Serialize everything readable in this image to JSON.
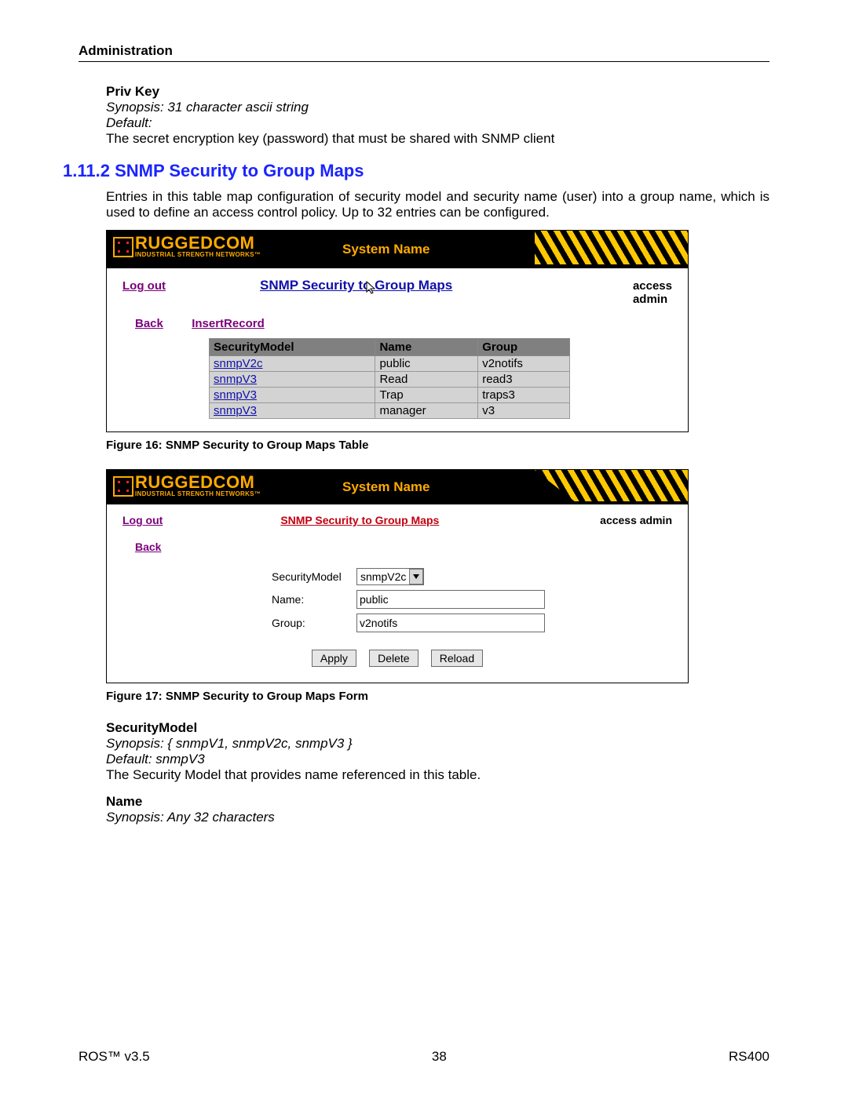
{
  "chapter": "Administration",
  "priv_key": {
    "heading": "Priv Key",
    "synopsis": "Synopsis: 31 character ascii string",
    "default": "Default:",
    "desc": "The secret encryption key (password) that must be shared with SNMP client"
  },
  "section": {
    "number_title": "1.11.2  SNMP Security to Group Maps",
    "para": "Entries in this table map configuration of security model and security name (user) into a group name, which is used to define an access control policy. Up to 32 entries can be configured."
  },
  "brand": {
    "name": "RUGGEDCOM",
    "tagline": "INDUSTRIAL STRENGTH NETWORKS™"
  },
  "screenshot1": {
    "system_name": "System Name",
    "logout": "Log out",
    "page_title": "SNMP Security to Group Maps",
    "access_line1": "access",
    "access_line2": "admin",
    "back": "Back",
    "insert_record": "InsertRecord",
    "columns": {
      "c1": "SecurityModel",
      "c2": "Name",
      "c3": "Group"
    },
    "rows": [
      {
        "model": "snmpV2c",
        "name": "public",
        "group": "v2notifs"
      },
      {
        "model": "snmpV3",
        "name": "Read",
        "group": "read3"
      },
      {
        "model": "snmpV3",
        "name": "Trap",
        "group": "traps3"
      },
      {
        "model": "snmpV3",
        "name": "manager",
        "group": "v3"
      }
    ],
    "caption": "Figure 16: SNMP Security to Group Maps Table"
  },
  "screenshot2": {
    "system_name": "System Name",
    "logout": "Log out",
    "page_title": "SNMP Security to Group Maps",
    "access": "access admin",
    "back": "Back",
    "labels": {
      "sec_model": "SecurityModel",
      "name": "Name:",
      "group": "Group:"
    },
    "values": {
      "sec_model": "snmpV2c",
      "name": "public",
      "group": "v2notifs"
    },
    "buttons": {
      "apply": "Apply",
      "delete": "Delete",
      "reload": "Reload"
    },
    "caption": "Figure 17: SNMP Security to Group Maps Form"
  },
  "security_model": {
    "heading": "SecurityModel",
    "synopsis": "Synopsis: { snmpV1, snmpV2c, snmpV3 }",
    "default": "Default: snmpV3",
    "desc": "The Security Model that provides name referenced in this table."
  },
  "name_field": {
    "heading": "Name",
    "synopsis": "Synopsis: Any 32 characters"
  },
  "footer": {
    "left": "ROS™  v3.5",
    "center": "38",
    "right": "RS400"
  }
}
